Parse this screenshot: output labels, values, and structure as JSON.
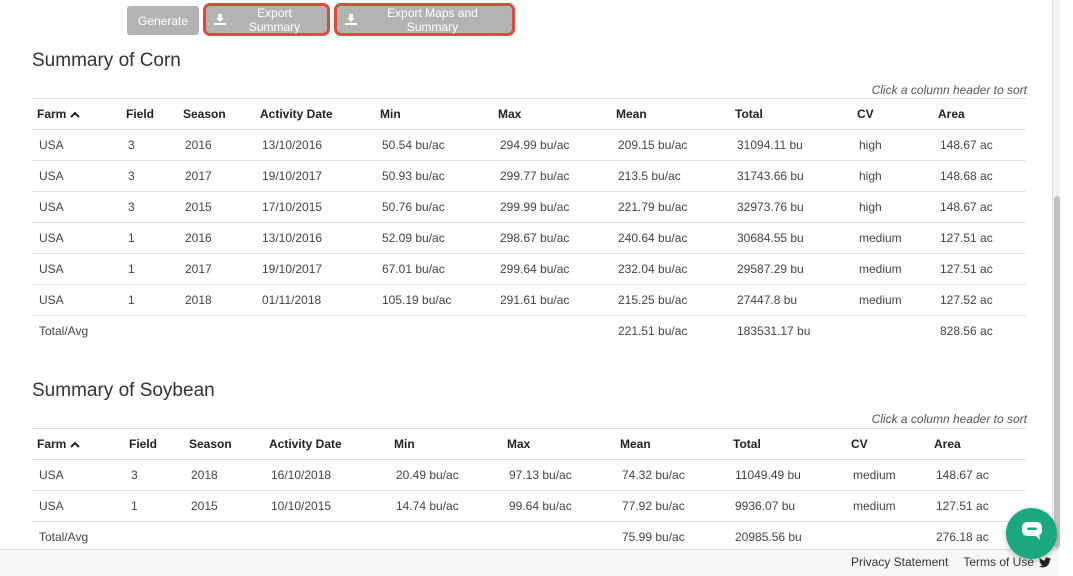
{
  "toolbar": {
    "generate_label": "Generate",
    "export_summary_label": "Export Summary",
    "export_maps_label": "Export Maps and Summary"
  },
  "corn": {
    "title": "Summary of Corn",
    "sort_hint": "Click a column header to sort",
    "columns": [
      "Farm",
      "Field",
      "Season",
      "Activity Date",
      "Min",
      "Max",
      "Mean",
      "Total",
      "CV",
      "Area"
    ],
    "rows": [
      [
        "USA",
        "3",
        "2016",
        "13/10/2016",
        "50.54 bu/ac",
        "294.99 bu/ac",
        "209.15 bu/ac",
        "31094.11 bu",
        "high",
        "148.67 ac"
      ],
      [
        "USA",
        "3",
        "2017",
        "19/10/2017",
        "50.93 bu/ac",
        "299.77 bu/ac",
        "213.5 bu/ac",
        "31743.66 bu",
        "high",
        "148.68 ac"
      ],
      [
        "USA",
        "3",
        "2015",
        "17/10/2015",
        "50.76 bu/ac",
        "299.99 bu/ac",
        "221.79 bu/ac",
        "32973.76 bu",
        "high",
        "148.67 ac"
      ],
      [
        "USA",
        "1",
        "2016",
        "13/10/2016",
        "52.09 bu/ac",
        "298.67 bu/ac",
        "240.64 bu/ac",
        "30684.55 bu",
        "medium",
        "127.51 ac"
      ],
      [
        "USA",
        "1",
        "2017",
        "19/10/2017",
        "67.01 bu/ac",
        "299.64 bu/ac",
        "232.04 bu/ac",
        "29587.29 bu",
        "medium",
        "127.51 ac"
      ],
      [
        "USA",
        "1",
        "2018",
        "01/11/2018",
        "105.19 bu/ac",
        "291.61 bu/ac",
        "215.25 bu/ac",
        "27447.8 bu",
        "medium",
        "127.52 ac"
      ]
    ],
    "total": {
      "label": "Total/Avg",
      "mean": "221.51 bu/ac",
      "total": "183531.17 bu",
      "area": "828.56 ac"
    }
  },
  "soybean": {
    "title": "Summary of Soybean",
    "sort_hint": "Click a column header to sort",
    "columns": [
      "Farm",
      "Field",
      "Season",
      "Activity Date",
      "Min",
      "Max",
      "Mean",
      "Total",
      "CV",
      "Area"
    ],
    "rows": [
      [
        "USA",
        "3",
        "2018",
        "16/10/2018",
        "20.49 bu/ac",
        "97.13 bu/ac",
        "74.32 bu/ac",
        "11049.49 bu",
        "medium",
        "148.67 ac"
      ],
      [
        "USA",
        "1",
        "2015",
        "10/10/2015",
        "14.74 bu/ac",
        "99.64 bu/ac",
        "77.92 bu/ac",
        "9936.07 bu",
        "medium",
        "127.51 ac"
      ]
    ],
    "total": {
      "label": "Total/Avg",
      "mean": "75.99 bu/ac",
      "total": "20985.56 bu",
      "area": "276.18 ac"
    }
  },
  "footer": {
    "privacy_label": "Privacy Statement",
    "terms_label": "Terms of Use"
  },
  "icons": {
    "download": "download-icon",
    "sort_caret": "caret-up-icon",
    "twitter": "twitter-icon",
    "chat": "chat-icon"
  },
  "colors": {
    "button_bg": "#b3b3b3",
    "highlight_outline": "#e0493b",
    "chat_bg": "#1aa87d"
  }
}
